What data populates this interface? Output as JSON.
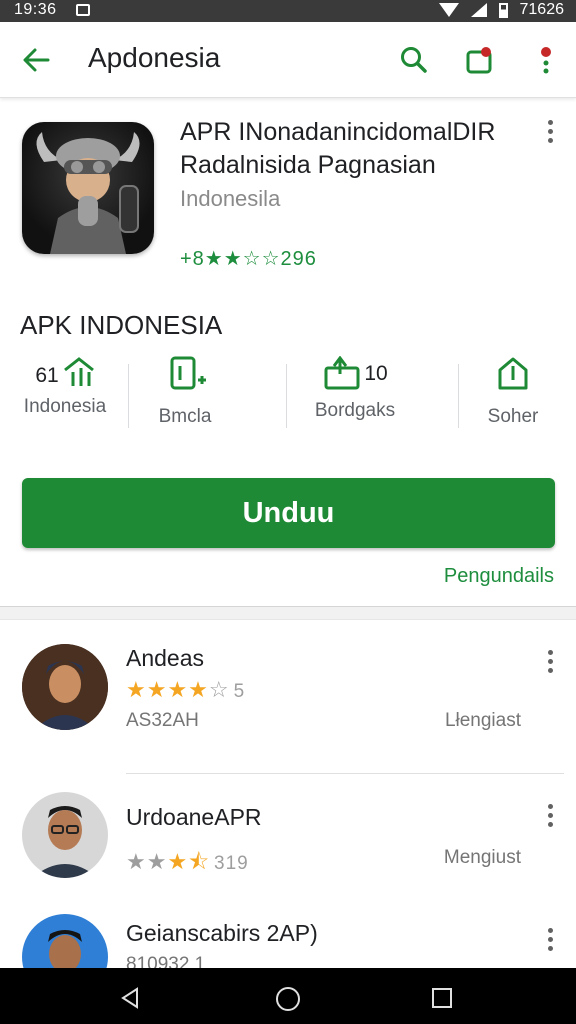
{
  "status_bar": {
    "time": "19:36",
    "right_text": "71626"
  },
  "app_bar": {
    "title": "Apdonesia"
  },
  "app": {
    "title": "APR INonadanincidomalDIR Radalnisida Pagnasian",
    "developer": "Indonesila",
    "rating_text": "+8★★☆☆296"
  },
  "section_title": "APK INDONESIA",
  "stats": [
    {
      "number": "61",
      "label": "Indonesia"
    },
    {
      "number": "",
      "label": "Bmcla"
    },
    {
      "number": "10",
      "label": "Bordgaks"
    },
    {
      "number": "",
      "label": "Soher"
    }
  ],
  "install_label": "Unduu",
  "more_link": "Pengundails",
  "reviews": [
    {
      "name": "Andeas",
      "rating": 4,
      "count": "5",
      "meta": "AS32AH",
      "right": "Lłengiast"
    },
    {
      "name": "UrdoaneAPR",
      "rating": 3.5,
      "count": "319",
      "meta": "",
      "right": "Mengiust"
    },
    {
      "name": "Geiansc⁠abirs 2AP)",
      "rating": 0,
      "count": "",
      "meta": "810932 1",
      "right": ""
    }
  ],
  "colors": {
    "accent": "#1e8a35",
    "star": "#f4a622",
    "text": "#202124"
  }
}
